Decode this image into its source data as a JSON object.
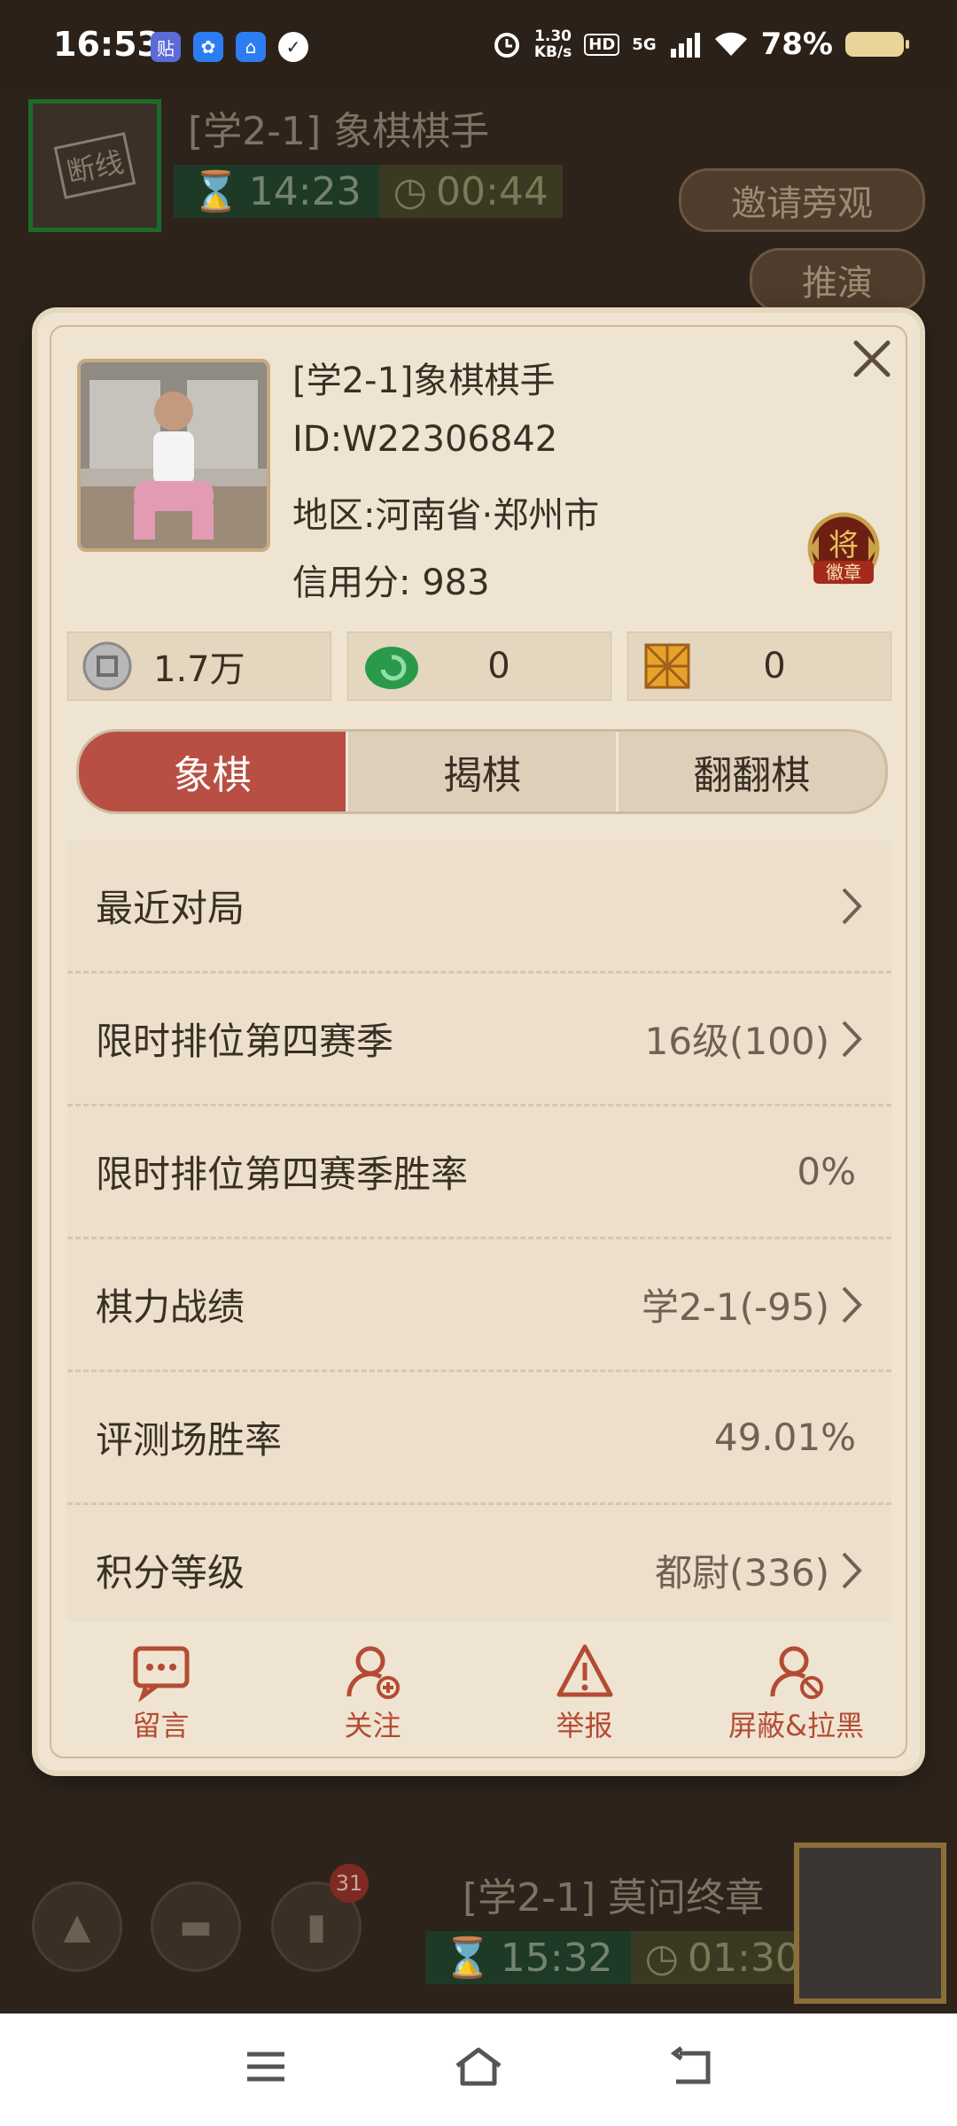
{
  "status_bar": {
    "time": "16:53",
    "app_icons": [
      "贴",
      "✿",
      "⌂",
      "✓"
    ],
    "net_speed_top": "1.30",
    "net_speed_bottom": "KB/s",
    "hd": "HD",
    "network": "5G",
    "battery": "78%"
  },
  "game": {
    "top_player": {
      "status_badge": "断线",
      "name": "[学2-1] 象棋棋手",
      "total_time": "14:23",
      "step_time": "00:44"
    },
    "invite_watch_label": "邀请旁观",
    "deduce_label": "推演",
    "bottom_player": {
      "name": "[学2-1] 莫问终章",
      "total_time": "15:32",
      "step_time": "01:30"
    },
    "notification_count": "31"
  },
  "profile": {
    "name": "[学2-1]象棋棋手",
    "id": "ID:W22306842",
    "region": "地区:河南省·郑州市",
    "credit": "信用分: 983",
    "badge_label": "将",
    "badge_sub": "徽章",
    "assets": [
      {
        "icon": "silver-coin-icon",
        "value": "1.7万"
      },
      {
        "icon": "jade-icon",
        "value": "0"
      },
      {
        "icon": "gold-card-icon",
        "value": "0"
      }
    ],
    "tabs": [
      "象棋",
      "揭棋",
      "翻翻棋"
    ],
    "active_tab": 0,
    "rows": [
      {
        "label": "最近对局",
        "value": ""
      },
      {
        "label": "限时排位第四赛季",
        "value": "16级(100)"
      },
      {
        "label": "限时排位第四赛季胜率",
        "value": "0%"
      },
      {
        "label": "棋力战绩",
        "value": "学2-1(-95)"
      },
      {
        "label": "评测场胜率",
        "value": "49.01%"
      },
      {
        "label": "积分等级",
        "value": "都尉(336)"
      }
    ],
    "actions": [
      "留言",
      "关注",
      "举报",
      "屏蔽&拉黑"
    ]
  },
  "colors": {
    "accent": "#b84f42",
    "action": "#b44b33",
    "panel": "#efe4d2"
  }
}
